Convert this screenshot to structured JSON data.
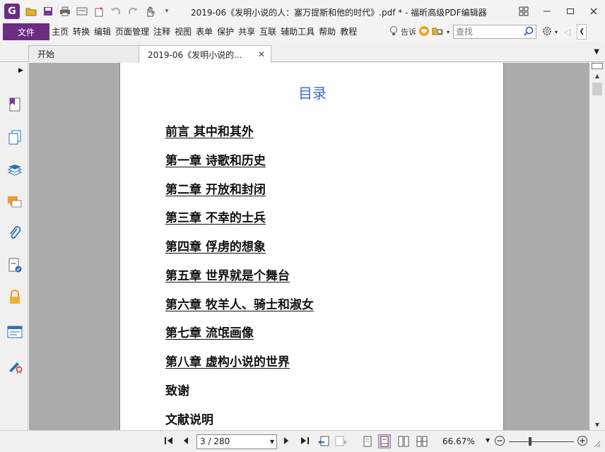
{
  "window": {
    "title": "2019-06《发明小说的人：塞万提斯和他的时代》.pdf * - 福昕高级PDF编辑器",
    "logo_letter": "G"
  },
  "menu": {
    "file": "文件",
    "items": [
      "主页",
      "转换",
      "编辑",
      "页面管理",
      "注释",
      "视图",
      "表单",
      "保护",
      "共享",
      "互联",
      "辅助工具",
      "帮助",
      "教程"
    ],
    "tell_me": "告诉",
    "search_placeholder": "查找"
  },
  "tabs": [
    {
      "label": "开始"
    },
    {
      "label": "2019-06《发明小说的..."
    }
  ],
  "document": {
    "toc_title": "目录",
    "entries": [
      "前言 其中和其外",
      "第一章 诗歌和历史",
      "第二章 开放和封闭",
      "第三章 不幸的士兵",
      "第四章 俘虏的想象",
      "第五章 世界就是个舞台",
      "第六章 牧羊人、骑士和淑女",
      "第七章 流氓画像",
      "第八章 虚构小说的世界",
      "致谢",
      "文献说明"
    ]
  },
  "status": {
    "page_display": "3 / 280",
    "zoom": "66.67%"
  },
  "colors": {
    "accent": "#6b2c82",
    "toc_title": "#3a6cc4",
    "doc_bg": "#ababab"
  }
}
